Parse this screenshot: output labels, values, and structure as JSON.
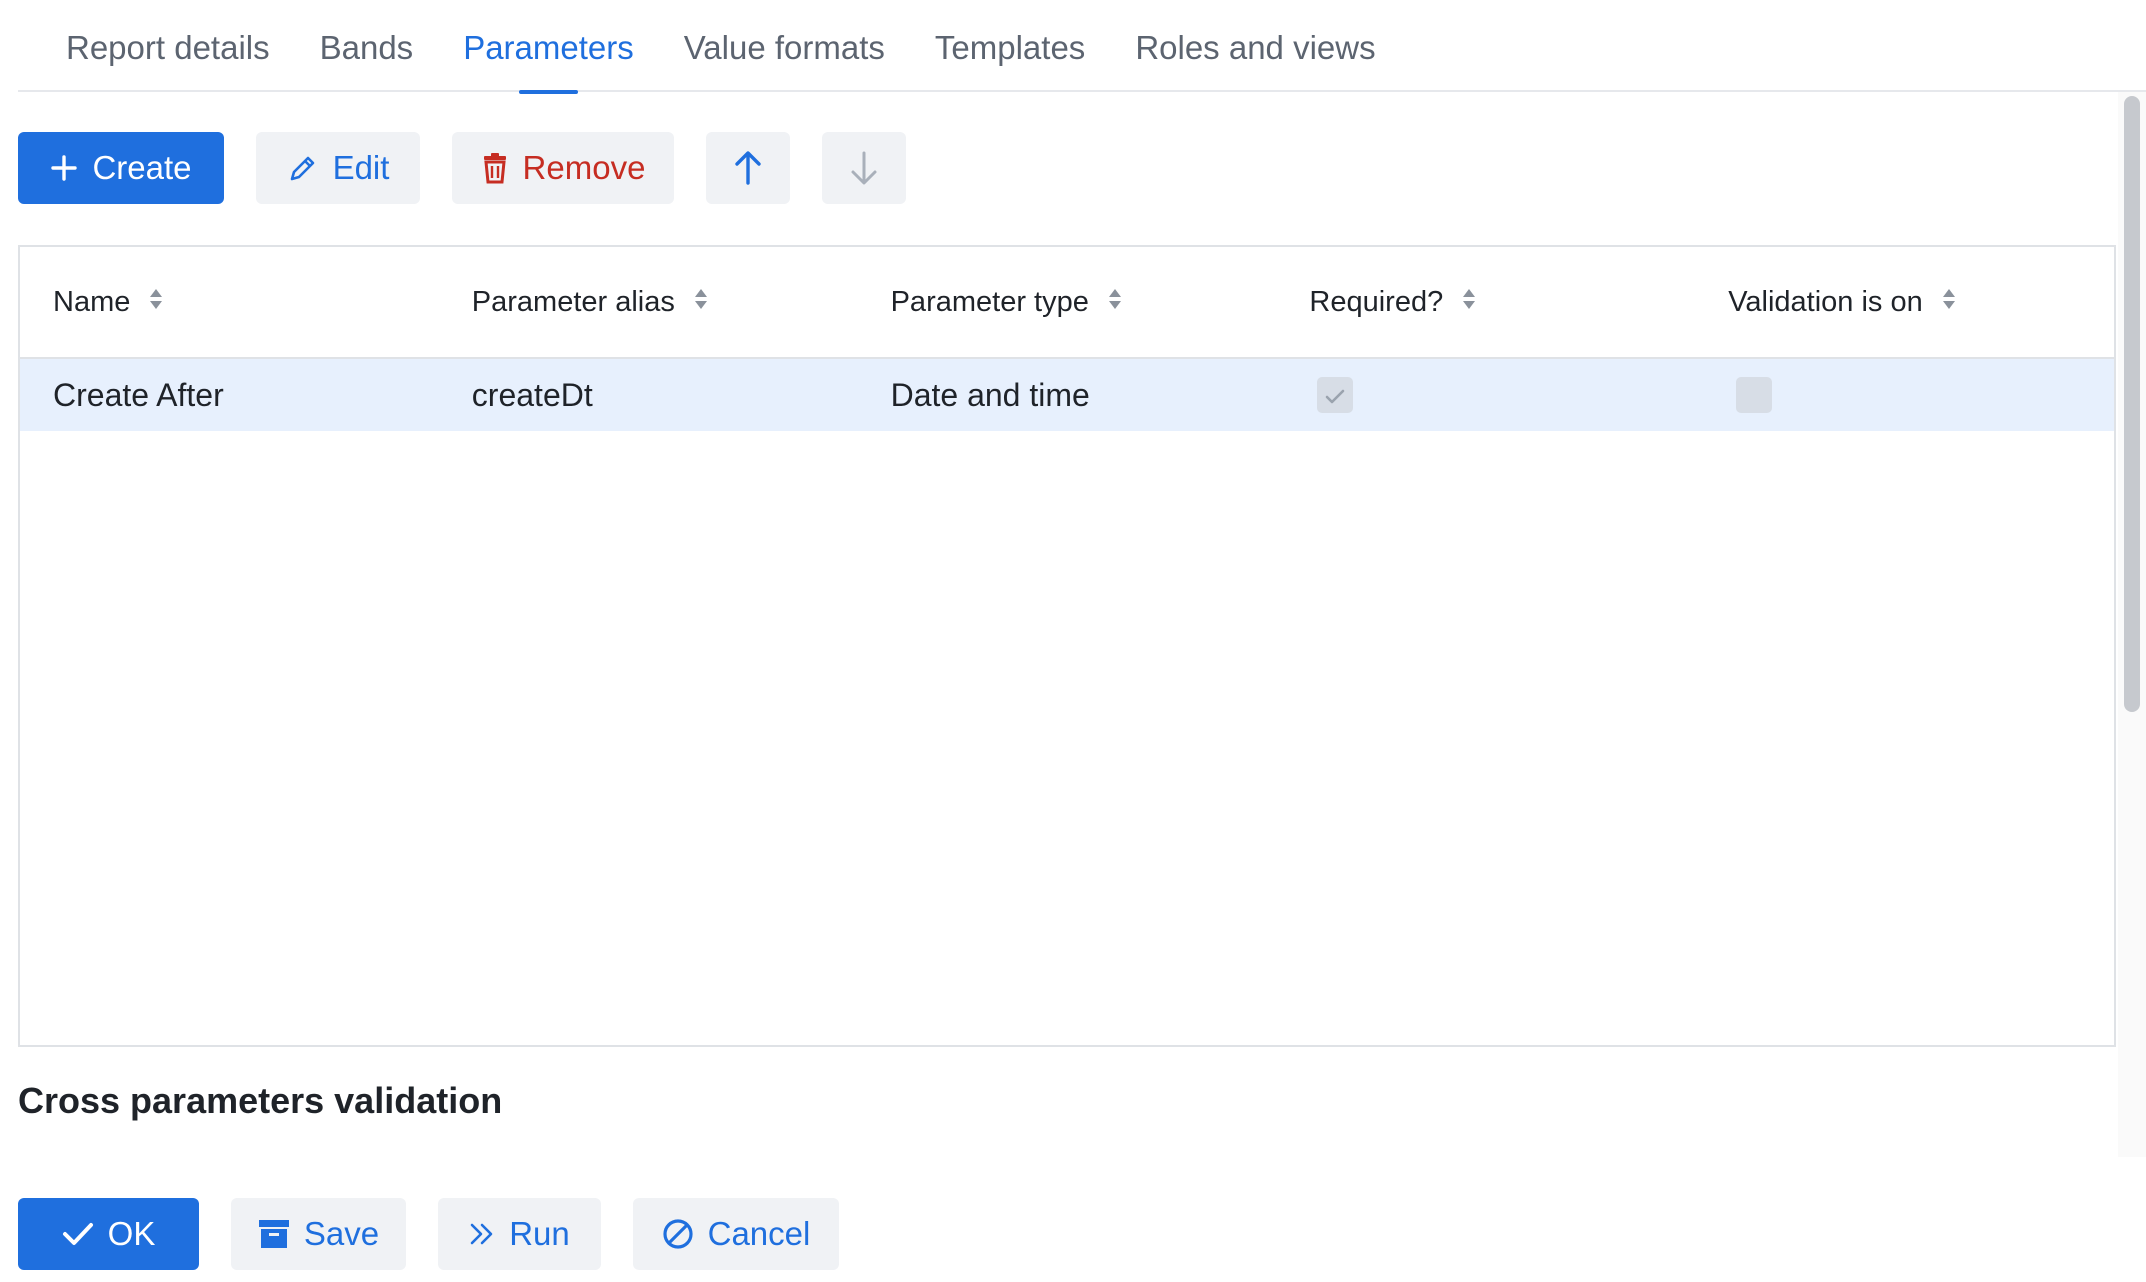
{
  "tabs": [
    {
      "label": "Report details",
      "active": false
    },
    {
      "label": "Bands",
      "active": false
    },
    {
      "label": "Parameters",
      "active": true
    },
    {
      "label": "Value formats",
      "active": false
    },
    {
      "label": "Templates",
      "active": false
    },
    {
      "label": "Roles and views",
      "active": false
    }
  ],
  "toolbar": {
    "create_label": "Create",
    "edit_label": "Edit",
    "remove_label": "Remove",
    "move_up_icon": "arrow-up-icon",
    "move_down_icon": "arrow-down-icon"
  },
  "table": {
    "columns": [
      "Name",
      "Parameter alias",
      "Parameter type",
      "Required?",
      "Validation is on"
    ],
    "rows": [
      {
        "name": "Create After",
        "alias": "createDt",
        "type": "Date and time",
        "required": true,
        "validation": false,
        "selected": true
      }
    ]
  },
  "section": {
    "title": "Cross parameters validation"
  },
  "footer": {
    "ok_label": "OK",
    "save_label": "Save",
    "run_label": "Run",
    "cancel_label": "Cancel"
  },
  "colors": {
    "accent": "#1f6fde",
    "danger": "#c62d22",
    "selected_row": "#e7f0fd"
  }
}
